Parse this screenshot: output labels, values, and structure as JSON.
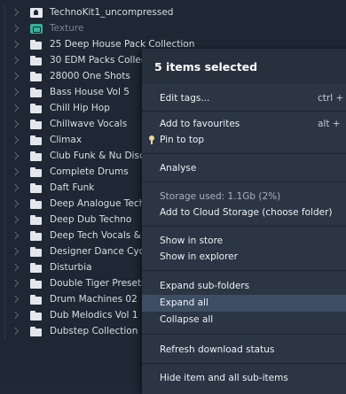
{
  "tree": {
    "items": [
      {
        "label": "TechnoKit1_uncompressed",
        "icon": "kit-icon",
        "dim": false
      },
      {
        "label": "Texture",
        "icon": "texture-icon",
        "dim": true
      },
      {
        "label": "25 Deep House Pack Collection",
        "icon": "folder-icon",
        "dim": false
      },
      {
        "label": "30 EDM Packs Collection",
        "icon": "folder-icon",
        "dim": false
      },
      {
        "label": "28000 One Shots",
        "icon": "folder-icon",
        "dim": false
      },
      {
        "label": "Bass House Vol 5",
        "icon": "folder-icon",
        "dim": false
      },
      {
        "label": "Chill Hip Hop",
        "icon": "folder-icon",
        "dim": false
      },
      {
        "label": "Chillwave Vocals",
        "icon": "folder-icon",
        "dim": false
      },
      {
        "label": "Climax",
        "icon": "folder-icon",
        "dim": false
      },
      {
        "label": "Club Funk & Nu Disco",
        "icon": "folder-icon",
        "dim": false
      },
      {
        "label": "Complete Drums",
        "icon": "folder-icon",
        "dim": false
      },
      {
        "label": "Daft Funk",
        "icon": "folder-icon",
        "dim": false
      },
      {
        "label": "Deep Analogue Techno",
        "icon": "folder-icon",
        "dim": false
      },
      {
        "label": "Deep Dub Techno",
        "icon": "folder-icon",
        "dim": false
      },
      {
        "label": "Deep Tech Vocals & Samples",
        "icon": "folder-icon",
        "dim": false
      },
      {
        "label": "Designer Dance Cycles",
        "icon": "folder-icon",
        "dim": false
      },
      {
        "label": "Disturbia",
        "icon": "folder-icon",
        "dim": false
      },
      {
        "label": "Double Tiger Presets",
        "icon": "folder-icon",
        "dim": false
      },
      {
        "label": "Drum Machines 02",
        "icon": "folder-icon",
        "dim": false
      },
      {
        "label": "Dub Melodics Vol 1",
        "icon": "folder-icon",
        "dim": false
      },
      {
        "label": "Dubstep Collection",
        "icon": "folder-icon",
        "dim": false
      }
    ]
  },
  "menu": {
    "title": "5 items selected",
    "items": [
      {
        "label": "Edit tags...",
        "shortcut": "ctrl +"
      },
      {
        "label": "Add to favourites",
        "shortcut": "alt +"
      },
      {
        "label": "Pin to top",
        "shortcut": ""
      },
      {
        "label": "Analyse",
        "shortcut": ""
      },
      {
        "label": "Storage used: 1.1Gb (2%)",
        "shortcut": ""
      },
      {
        "label": "Add to Cloud Storage (choose folder)",
        "shortcut": ""
      },
      {
        "label": "Show in store",
        "shortcut": ""
      },
      {
        "label": "Show in explorer",
        "shortcut": ""
      },
      {
        "label": "Expand sub-folders",
        "shortcut": ""
      },
      {
        "label": "Expand all",
        "shortcut": ""
      },
      {
        "label": "Collapse all",
        "shortcut": ""
      },
      {
        "label": "Refresh download status",
        "shortcut": ""
      },
      {
        "label": "Hide item and all sub-items",
        "shortcut": ""
      }
    ]
  },
  "colors": {
    "background": "#1e2733",
    "menu_background": "#2b3544",
    "highlight": "#3d4f65",
    "texture_accent": "#35b39a",
    "pin_accent": "#e8d79a"
  }
}
